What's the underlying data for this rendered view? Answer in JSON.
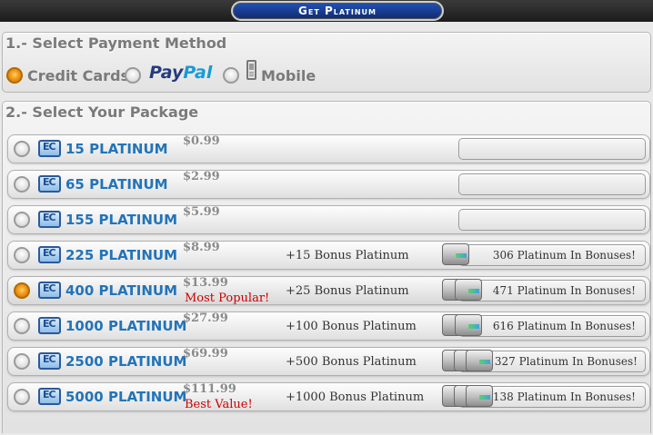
{
  "header": {
    "title": "Get Platinum"
  },
  "payment": {
    "title": "1.- Select Payment Method",
    "options": [
      {
        "label": "Credit Cards",
        "selected": true
      },
      {
        "label_pay": "Pay",
        "label_pal": "Pal",
        "selected": false
      },
      {
        "label": "Mobile",
        "selected": false
      }
    ]
  },
  "packages": {
    "title": "2.- Select Your Package",
    "items": [
      {
        "amount": "15 PLATINUM",
        "price": "$0.99",
        "tag": "",
        "bonus": "",
        "bonus_total": "",
        "selected": false
      },
      {
        "amount": "65 PLATINUM",
        "price": "$2.99",
        "tag": "",
        "bonus": "",
        "bonus_total": "",
        "selected": false
      },
      {
        "amount": "155 PLATINUM",
        "price": "$5.99",
        "tag": "",
        "bonus": "",
        "bonus_total": "",
        "selected": false
      },
      {
        "amount": "225 PLATINUM",
        "price": "$8.99",
        "tag": "",
        "bonus": "+15 Bonus Platinum",
        "bonus_total": "306 Platinum In Bonuses!",
        "selected": false
      },
      {
        "amount": "400 PLATINUM",
        "price": "$13.99",
        "tag": "Most Popular!",
        "bonus": "+25 Bonus Platinum",
        "bonus_total": "471 Platinum In Bonuses!",
        "selected": true
      },
      {
        "amount": "1000 PLATINUM",
        "price": "$27.99",
        "tag": "",
        "bonus": "+100 Bonus Platinum",
        "bonus_total": "616 Platinum In Bonuses!",
        "selected": false
      },
      {
        "amount": "2500 PLATINUM",
        "price": "$69.99",
        "tag": "",
        "bonus": "+500 Bonus Platinum",
        "bonus_total": "1327 Platinum In Bonuses!",
        "selected": false
      },
      {
        "amount": "5000 PLATINUM",
        "price": "$111.99",
        "tag": "Best Value!",
        "bonus": "+1000 Bonus Platinum",
        "bonus_total": "2138 Platinum In Bonuses!",
        "selected": false
      }
    ]
  },
  "icons": {
    "currency": "platinum-card-icon",
    "crate": "bonus-crate-icon",
    "mobile": "mobile-phone-icon"
  },
  "colors": {
    "accent": "#2274b9",
    "tag": "#cc0000",
    "selected_radio": "#f19a1a",
    "title_bar": "#1b3f9a"
  }
}
